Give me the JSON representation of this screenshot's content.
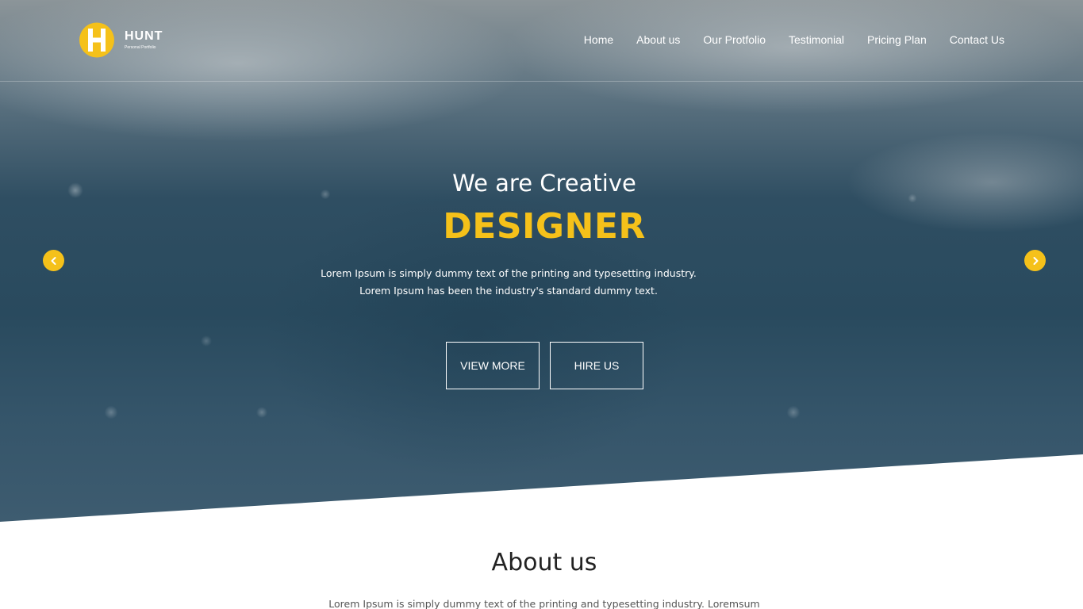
{
  "brand": {
    "logo_word": "HUNT",
    "logo_tagline": "Personal Portfolio",
    "accent_color": "#f5c11a"
  },
  "nav": {
    "items": [
      {
        "label": "Home"
      },
      {
        "label": "About us"
      },
      {
        "label": "Our Protfolio"
      },
      {
        "label": "Testimonial"
      },
      {
        "label": "Pricing Plan"
      },
      {
        "label": "Contact Us"
      }
    ]
  },
  "hero": {
    "kicker": "We are Creative",
    "title": "DESIGNER",
    "text": "Lorem Ipsum is simply dummy text of the printing and typesetting industry. Lorem Ipsum has been the industry's standard dummy text.",
    "buttons": {
      "view_more": "VIEW MORE",
      "hire_us": "HIRE US"
    },
    "prev_icon": "chevron-left-icon",
    "next_icon": "chevron-right-icon"
  },
  "about": {
    "title": "About us",
    "text": "Lorem Ipsum is simply dummy text of the printing and typesetting industry. Loremsum"
  }
}
